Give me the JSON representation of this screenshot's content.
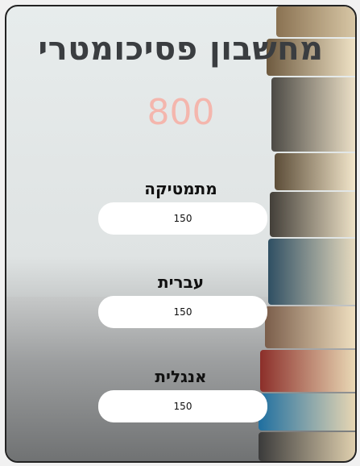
{
  "app": {
    "title": "מחשבון פסיכומטרי",
    "score": "800"
  },
  "sections": [
    {
      "label": "מתמטיקה",
      "value": "150"
    },
    {
      "label": "עברית",
      "value": "150"
    },
    {
      "label": "אנגלית",
      "value": "150"
    }
  ],
  "colors": {
    "score": "#f4b6ad",
    "title": "#3a3d40",
    "field_bg": "#ffffff"
  }
}
